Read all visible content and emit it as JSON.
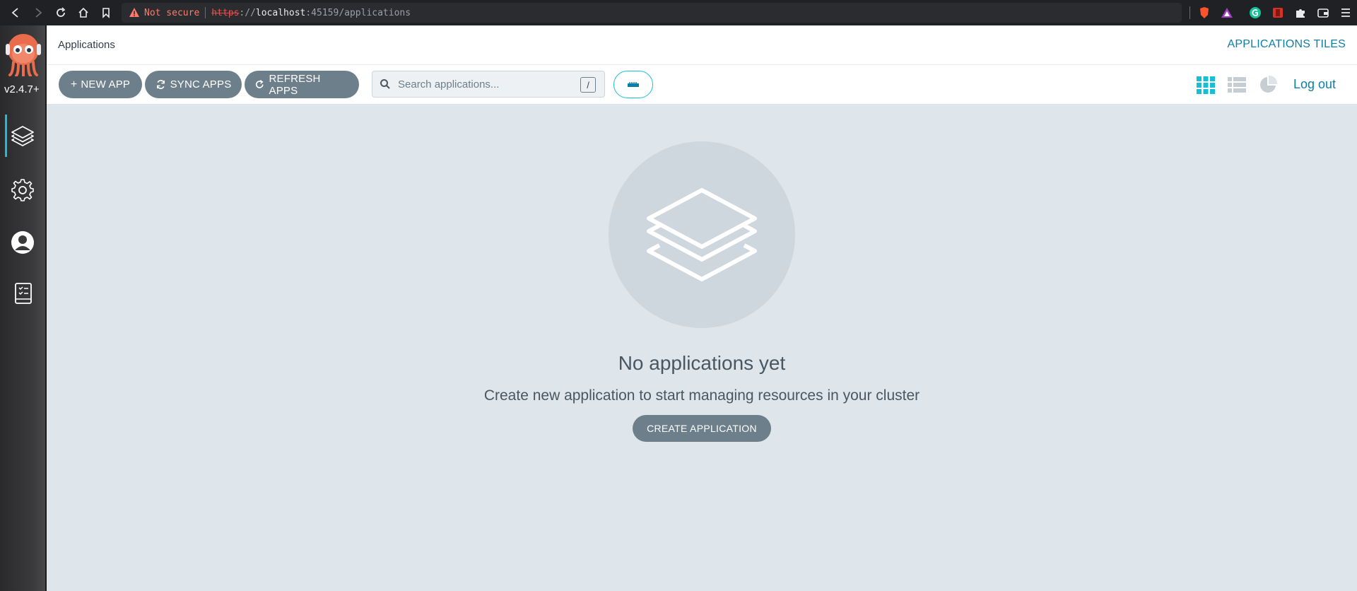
{
  "browser": {
    "not_secure": "Not secure",
    "url_proto": "https",
    "url_sep": "://",
    "url_host": "localhost",
    "url_rest": ":45159/applications"
  },
  "sidebar": {
    "version": "v2.4.7+",
    "items": [
      {
        "name": "applications",
        "icon": "layers-icon"
      },
      {
        "name": "settings",
        "icon": "gear-icon"
      },
      {
        "name": "user-info",
        "icon": "user-icon"
      },
      {
        "name": "documentation",
        "icon": "book-icon"
      }
    ]
  },
  "header": {
    "title": "Applications",
    "view_label": "APPLICATIONS TILES"
  },
  "toolbar": {
    "new_app": "NEW APP",
    "sync_apps": "SYNC APPS",
    "refresh_apps": "REFRESH APPS",
    "search_placeholder": "Search applications...",
    "search_shortcut": "/",
    "logout": "Log out"
  },
  "empty_state": {
    "title": "No applications yet",
    "subtitle": "Create new application to start managing resources in your cluster",
    "button": "CREATE APPLICATION"
  },
  "colors": {
    "accent": "#18bed4",
    "link": "#0c7fa8",
    "button": "#6d7f8b",
    "background": "#dee6eb"
  }
}
